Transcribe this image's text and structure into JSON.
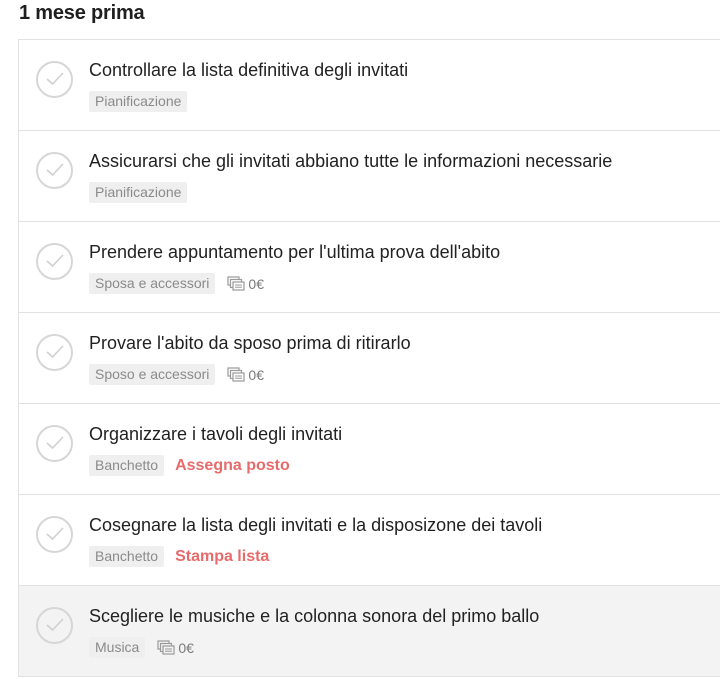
{
  "section": {
    "title": "1 mese prima"
  },
  "tasks": [
    {
      "title": "Controllare la lista definitiva degli invitati",
      "category": "Pianificazione"
    },
    {
      "title": "Assicurarsi che gli invitati abbiano tutte le informazioni necessarie",
      "category": "Pianificazione"
    },
    {
      "title": "Prendere appuntamento per l'ultima prova dell'abito",
      "category": "Sposa e accessori",
      "cost": "0€",
      "cost_icon": "banknotes-icon"
    },
    {
      "title": "Provare l'abito da sposo prima di ritirarlo",
      "category": "Sposo e accessori",
      "cost": "0€",
      "cost_icon": "banknotes-icon"
    },
    {
      "title": "Organizzare i tavoli degli invitati",
      "category": "Banchetto",
      "action": "Assegna posto"
    },
    {
      "title": "Cosegnare la lista degli invitati e la disposizone dei tavoli",
      "category": "Banchetto",
      "action": "Stampa lista"
    },
    {
      "title": "Scegliere le musiche e la colonna sonora del primo ballo",
      "category": "Musica",
      "cost": "0€",
      "cost_icon": "banknotes-icon"
    }
  ],
  "colors": {
    "action": "#e86b6b",
    "tag_bg": "#efefef",
    "check_border": "#d6d6d6",
    "hover_row": "#f3f3f3"
  }
}
